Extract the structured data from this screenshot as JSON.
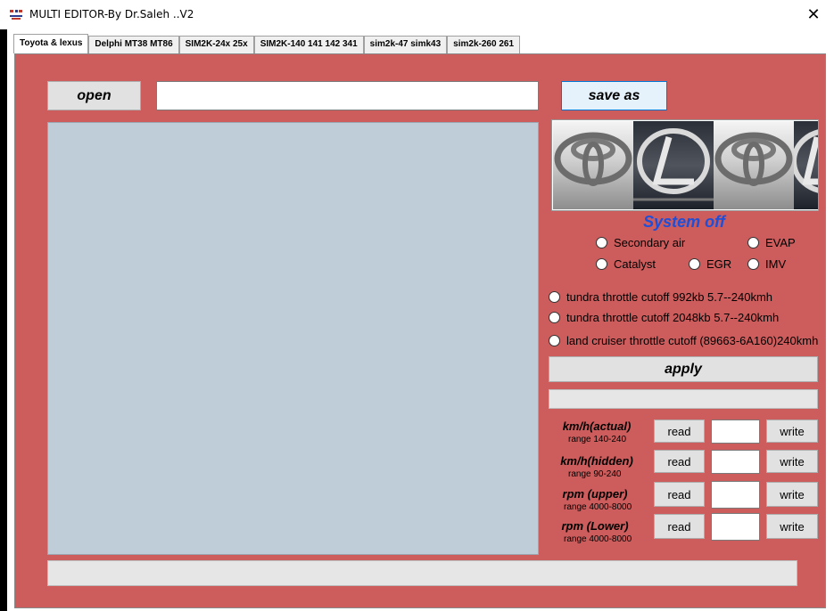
{
  "window": {
    "title": "MULTI EDITOR-By Dr.Saleh ..V2",
    "close_glyph": "✕",
    "app_icon": "app-icon"
  },
  "tabs": [
    {
      "label": "Toyota & lexus",
      "active": true
    },
    {
      "label": "Delphi MT38 MT86",
      "active": false
    },
    {
      "label": "SIM2K-24x 25x",
      "active": false
    },
    {
      "label": "SIM2K-140 141 142 341",
      "active": false
    },
    {
      "label": "sim2k-47 simk43",
      "active": false
    },
    {
      "label": "sim2k-260 261",
      "active": false
    }
  ],
  "toolbar": {
    "open_label": "open",
    "file_path_value": "",
    "save_as_label": "save as"
  },
  "logo_strip": {
    "tiles": [
      "toyota-logo",
      "lexus-logo",
      "toyota-logo",
      "lexus-logo"
    ]
  },
  "system_off": {
    "heading": "System off",
    "options": {
      "secondary_air": "Secondary air",
      "evap": "EVAP",
      "catalyst": "Catalyst",
      "egr": "EGR",
      "imv": "IMV"
    }
  },
  "throttle_options": [
    "tundra throttle cutoff 992kb 5.7--240kmh",
    "tundra throttle cutoff 2048kb 5.7--240kmh",
    "land cruiser throttle cutoff (89663-6A160)240kmh"
  ],
  "apply_label": "apply",
  "status_value": "",
  "limits": [
    {
      "label": "km/h(actual)",
      "range": "range 140-240",
      "read": "read",
      "write": "write",
      "value": ""
    },
    {
      "label": "km/h(hidden)",
      "range": "range 90-240",
      "read": "read",
      "write": "write",
      "value": ""
    },
    {
      "label": "rpm (upper)",
      "range": "range 4000-8000",
      "read": "read",
      "write": "write",
      "value": ""
    },
    {
      "label": "rpm (Lower)",
      "range": "range 4000-8000",
      "read": "read",
      "write": "write",
      "value": ""
    }
  ],
  "bottom_bar_value": "",
  "colors": {
    "panel": "#cd5c5c",
    "text_area": "#bfcdd9",
    "system_off": "#1e4fd8",
    "save_as_bg": "#e5f1fb"
  }
}
